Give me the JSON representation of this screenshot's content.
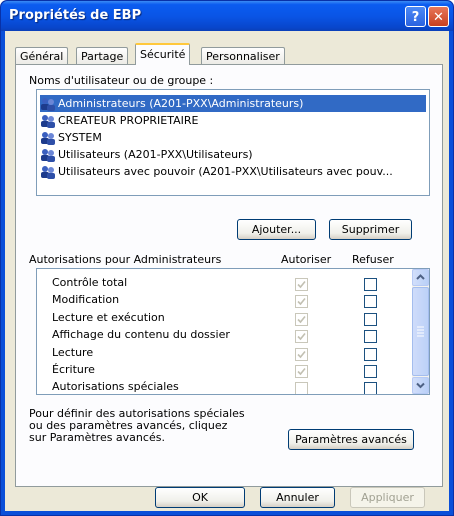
{
  "window": {
    "title": "Propriétés de EBP",
    "help_glyph": "?",
    "close_glyph": "✕"
  },
  "tabs": [
    {
      "label": "Général",
      "active": false
    },
    {
      "label": "Partage",
      "active": false
    },
    {
      "label": "Sécurité",
      "active": true
    },
    {
      "label": "Personnaliser",
      "active": false
    }
  ],
  "security": {
    "users_label": "Noms d'utilisateur ou de groupe :",
    "users": [
      {
        "name": "Administrateurs (A201-PXX\\Administrateurs)",
        "selected": true,
        "icon": "user-group-icon"
      },
      {
        "name": "CREATEUR PROPRIETAIRE",
        "selected": false,
        "icon": "user-group-icon"
      },
      {
        "name": "SYSTEM",
        "selected": false,
        "icon": "user-group-icon"
      },
      {
        "name": "Utilisateurs (A201-PXX\\Utilisateurs)",
        "selected": false,
        "icon": "user-group-icon"
      },
      {
        "name": "Utilisateurs avec pouvoir (A201-PXX\\Utilisateurs avec pouv...",
        "selected": false,
        "icon": "user-group-icon"
      }
    ],
    "add_button": "Ajouter...",
    "remove_button": "Supprimer",
    "permissions_label": "Autorisations pour Administrateurs",
    "allow_header": "Autoriser",
    "deny_header": "Refuser",
    "permissions": [
      {
        "name": "Contrôle total",
        "allow": true,
        "deny": false
      },
      {
        "name": "Modification",
        "allow": true,
        "deny": false
      },
      {
        "name": "Lecture et exécution",
        "allow": true,
        "deny": false
      },
      {
        "name": "Affichage du contenu du dossier",
        "allow": true,
        "deny": false
      },
      {
        "name": "Lecture",
        "allow": true,
        "deny": false
      },
      {
        "name": "Écriture",
        "allow": true,
        "deny": false
      },
      {
        "name": "Autorisations spéciales",
        "allow": false,
        "deny": false
      }
    ],
    "advanced_text": [
      "Pour définir des autorisations spéciales",
      "ou des paramètres avancés, cliquez",
      "sur Paramètres avancés."
    ],
    "advanced_button": "Paramètres avancés"
  },
  "footer": {
    "ok": "OK",
    "cancel": "Annuler",
    "apply": "Appliquer"
  },
  "colors": {
    "titlebar": "#0a55e6",
    "selection": "#316ac5",
    "dialog_bg": "#ece9d8"
  }
}
